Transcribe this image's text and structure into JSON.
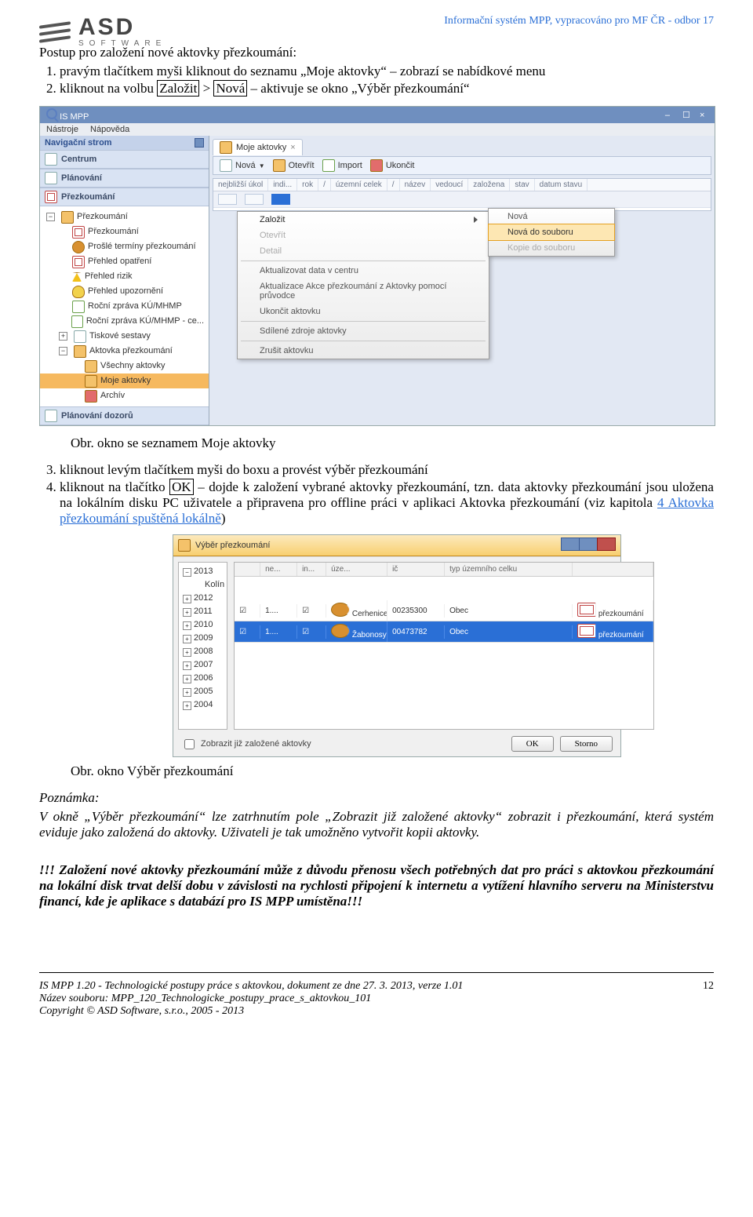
{
  "logo": {
    "big": "ASD",
    "small": "SOFTWARE"
  },
  "header_right": "Informační systém MPP, vypracováno pro MF ČR - odbor 17",
  "intro": "Postup pro založení nové aktovky přezkoumání:",
  "steps12": [
    "pravým tlačítkem myši kliknout do seznamu „Moje aktovky“ – zobrazí se nabídkové menu",
    "kliknout na volbu Založit > Nová – aktivuje se okno „Výběr přezkoumání“"
  ],
  "caption1": "Obr. okno se seznamem Moje aktovky",
  "steps34": [
    "kliknout levým tlačítkem myši do boxu a provést výběr přezkoumání",
    "kliknout na tlačítko OK – dojde k založení vybrané aktovky přezkoumání, tzn. data aktovky přezkoumání jsou uložena na lokálním disku PC uživatele a připravena pro offline práci v aplikaci Aktovka přezkoumání (viz kapitola 4  Aktovka přezkoumání spuštěná lokálně)"
  ],
  "ok_box": "OK",
  "link_text": "4  Aktovka přezkoumání spuštěná lokálně",
  "caption2": "Obr. okno Výběr přezkoumání",
  "note_label": "Poznámka:",
  "note_body": "V okně „Výběr přezkoumání“ lze zatrhnutím pole „Zobrazit již založené aktovky“ zobrazit i přezkoumání, která systém eviduje jako založená do aktovky. Uživateli je tak umožněno vytvořit kopii aktovky.",
  "warn_body": "!!! Založení nové aktovky přezkoumání může z důvodu přenosu všech potřebných dat pro práci s aktovkou přezkoumání na lokální disk trvat delší dobu v závislosti na rychlosti připojení k internetu a vytížení hlavního serveru na Ministerstvu financí, kde je aplikace s databází pro IS MPP umístěna!!!",
  "shot1": {
    "title": "IS MPP",
    "menu": [
      "Nástroje",
      "Nápověda"
    ],
    "nav_head": "Navigační strom",
    "sections": [
      "Centrum",
      "Plánování",
      "Přezkoumání",
      "Plánování dozorů"
    ],
    "tree": [
      {
        "lvl": 0,
        "icon": "fold",
        "label": "Přezkoumání",
        "tog": "-"
      },
      {
        "lvl": 1,
        "icon": "filev",
        "label": "Přezkoumání"
      },
      {
        "lvl": 1,
        "icon": "user",
        "label": "Prošlé termíny přezkoumání"
      },
      {
        "lvl": 1,
        "icon": "filev",
        "label": "Přehled opatření"
      },
      {
        "lvl": 1,
        "icon": "warn",
        "label": "Přehled rizik"
      },
      {
        "lvl": 1,
        "icon": "bell",
        "label": "Přehled upozornění"
      },
      {
        "lvl": 1,
        "icon": "docv",
        "label": "Roční zpráva KÚ/MHMP"
      },
      {
        "lvl": 1,
        "icon": "docv",
        "label": "Roční zpráva KÚ/MHMP - ce..."
      },
      {
        "lvl": 1,
        "icon": "file",
        "label": "Tiskové sestavy",
        "tog": "+"
      },
      {
        "lvl": 1,
        "icon": "fold",
        "label": "Aktovka přezkoumání",
        "tog": "-"
      },
      {
        "lvl": 2,
        "icon": "fold",
        "label": "Všechny aktovky"
      },
      {
        "lvl": 2,
        "icon": "fold",
        "label": "Moje aktovky",
        "sel": true
      },
      {
        "lvl": 2,
        "icon": "redf",
        "label": "Archív"
      }
    ],
    "tab": "Moje aktovky",
    "toolbar": [
      "Nová",
      "Otevřít",
      "Import",
      "Ukončit"
    ],
    "grid_cols": [
      "nejbližší úkol",
      "indi...",
      "rok",
      "/",
      "územní celek",
      "/",
      "název",
      "vedoucí",
      "založena",
      "stav",
      "datum stavu"
    ],
    "ctx": [
      {
        "label": "Založit",
        "arrow": true
      },
      {
        "label": "Otevřít"
      },
      {
        "label": "Detail"
      },
      {
        "sep": true
      },
      {
        "label": "Aktualizovat data v centru"
      },
      {
        "label": "Aktualizace Akce přezkoumání z Aktovky pomocí průvodce"
      },
      {
        "label": "Ukončit aktovku"
      },
      {
        "sep": true
      },
      {
        "label": "Sdílené zdroje aktovky"
      },
      {
        "sep": true
      },
      {
        "label": "Zrušit aktovku"
      }
    ],
    "submenu": [
      "Nová",
      "Nová do souboru",
      "Kopie do souboru"
    ]
  },
  "shot2": {
    "title": "Výběr přezkoumání",
    "years": [
      "2013",
      "2012",
      "2011",
      "2010",
      "2009",
      "2008",
      "2007",
      "2006",
      "2005",
      "2004"
    ],
    "year_child": "Kolín",
    "grid_cols": [
      "",
      "ne...",
      "in...",
      "úze...",
      "ič",
      "typ územního celku",
      ""
    ],
    "rows": [
      {
        "cells": [
          "☑",
          "1....",
          "☑",
          "Cerhenice",
          "00235300",
          "Obec",
          "přezkoumání"
        ],
        "sel": false,
        "icon": "user"
      },
      {
        "cells": [
          "☑",
          "1....",
          "☑",
          "Žabonosy",
          "00473782",
          "Obec",
          "přezkoumání"
        ],
        "sel": true,
        "icon": "user"
      }
    ],
    "chk_label": "Zobrazit již založené aktovky",
    "btn_ok": "OK",
    "btn_storno": "Storno"
  },
  "footer": {
    "l1": "IS MPP 1.20 - Technologické postupy práce s aktovkou, dokument ze dne 27. 3. 2013, verze 1.01",
    "l2": "Název souboru: MPP_120_Technologicke_postupy_prace_s_aktovkou_101",
    "l3": "Copyright © ASD Software, s.r.o., 2005 - 2013",
    "page": "12"
  }
}
